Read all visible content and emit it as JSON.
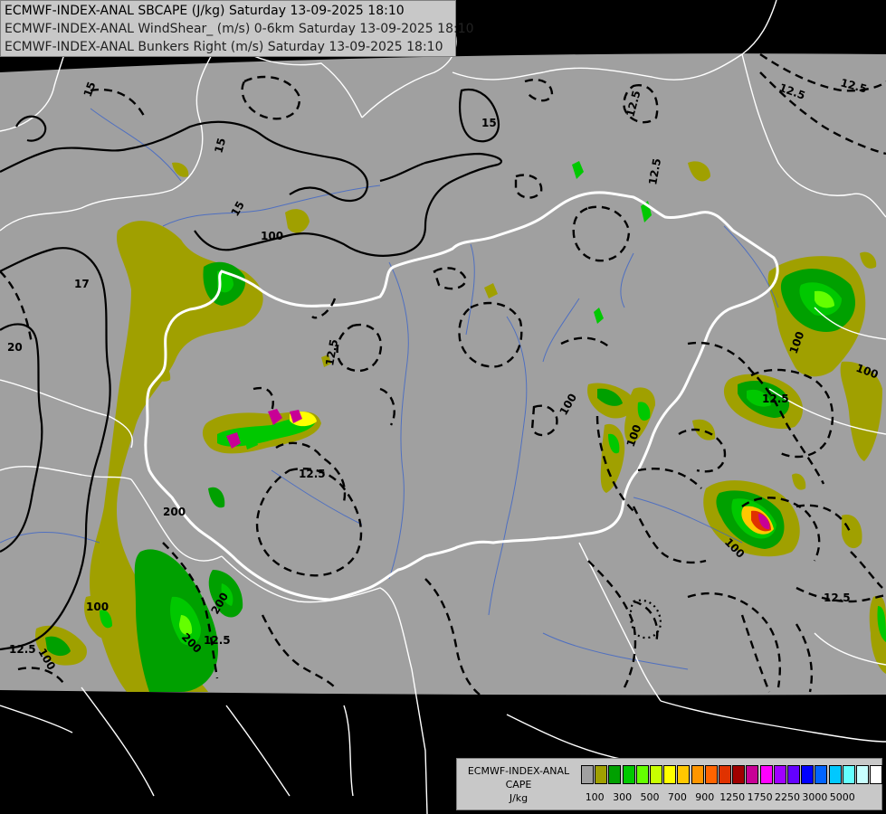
{
  "titles": {
    "line1": "ECMWF-INDEX-ANAL SBCAPE (J/kg) Saturday 13-09-2025 18:10",
    "line2": "ECMWF-INDEX-ANAL WindShear_ (m/s) 0-6km Saturday 13-09-2025 18:10",
    "line3": "ECMWF-INDEX-ANAL Bunkers Right (m/s) Saturday 13-09-2025 18:10"
  },
  "legend": {
    "line1": "ECMWF-INDEX-ANAL",
    "line2": "CAPE",
    "line3": "J/kg",
    "colors": [
      "#a0a0a0",
      "#a0a000",
      "#00a000",
      "#00c800",
      "#64ff00",
      "#c8ff00",
      "#ffff00",
      "#ffc800",
      "#ff9600",
      "#ff6400",
      "#e03200",
      "#a00000",
      "#c80096",
      "#ff00ff",
      "#a000ff",
      "#6400ff",
      "#0000ff",
      "#0064ff",
      "#00c8ff",
      "#64ffff",
      "#c8ffff",
      "#ffffff"
    ],
    "ticks": [
      "100",
      "300",
      "500",
      "700",
      "900",
      "1250",
      "1750",
      "2250",
      "3000",
      "5000"
    ]
  },
  "contour_labels": {
    "cape": [
      "100",
      "100",
      "100",
      "100",
      "100",
      "100",
      "100",
      "100",
      "200",
      "200",
      "200"
    ],
    "shear": [
      "15",
      "15",
      "15",
      "15",
      "17",
      "20",
      "12.5",
      "12.5",
      "12.5",
      "12.5",
      "12.5",
      "12.5",
      "12.5",
      "12.5",
      "12.5",
      "12.5"
    ]
  }
}
